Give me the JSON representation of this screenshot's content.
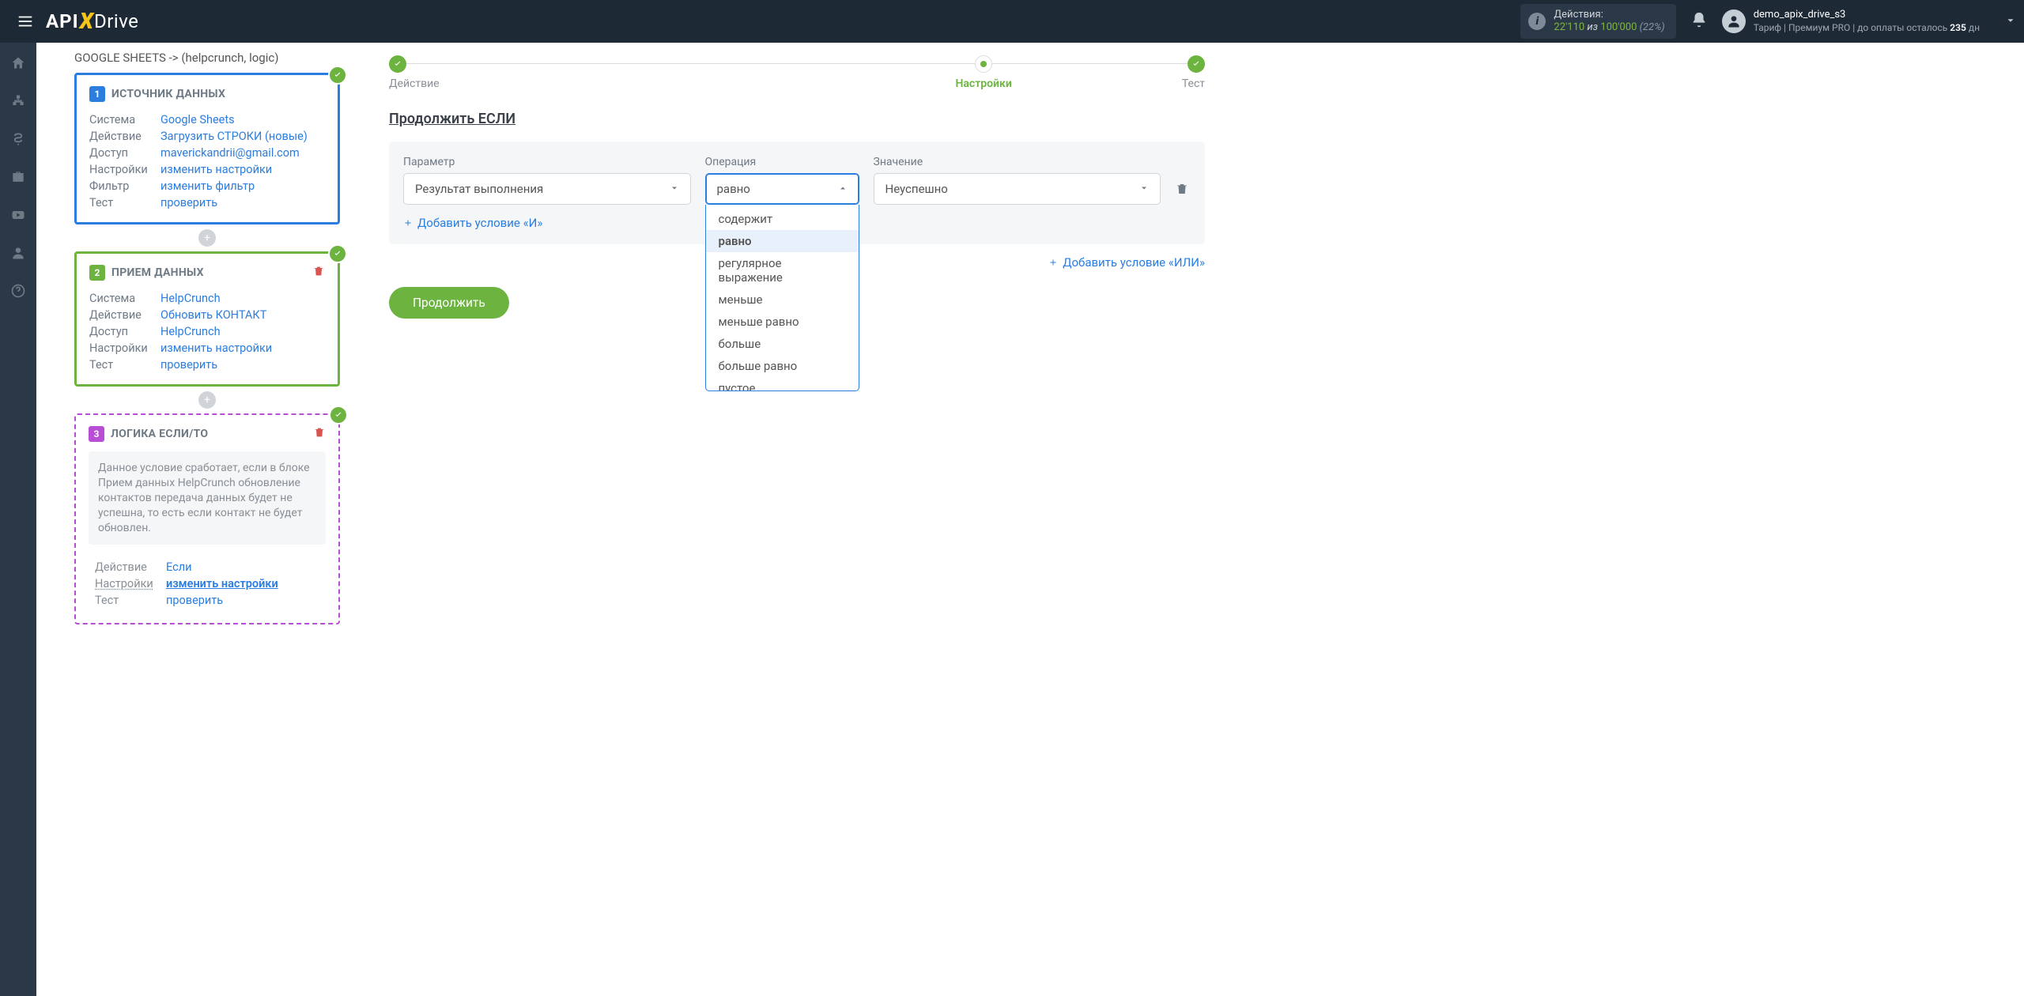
{
  "header": {
    "logo_api": "API",
    "logo_x": "X",
    "logo_drive": "Drive",
    "actions_label": "Действия:",
    "actions_count": "22'110",
    "actions_of": " из ",
    "actions_total": "100'000",
    "actions_pct": " (22%)",
    "user_name": "demo_apix_drive_s3",
    "user_meta_prefix": "Тариф | Премиум PRO |  до оплаты осталось ",
    "user_meta_days": "235",
    "user_meta_suffix": " дн"
  },
  "breadcrumb_title": "GOOGLE SHEETS -> (helpcrunch, logic)",
  "source_card": {
    "title": "ИСТОЧНИК ДАННЫХ",
    "rows": {
      "system_k": "Система",
      "system_v": "Google Sheets",
      "action_k": "Действие",
      "action_v": "Загрузить СТРОКИ (новые)",
      "access_k": "Доступ",
      "access_v": "maverickandrii@gmail.com",
      "settings_k": "Настройки",
      "settings_v": "изменить настройки",
      "filter_k": "Фильтр",
      "filter_v": "изменить фильтр",
      "test_k": "Тест",
      "test_v": "проверить"
    }
  },
  "dest_card": {
    "title": "ПРИЕМ ДАННЫХ",
    "rows": {
      "system_k": "Система",
      "system_v": "HelpCrunch",
      "action_k": "Действие",
      "action_v": "Обновить КОНТАКТ",
      "access_k": "Доступ",
      "access_v": "HelpCrunch",
      "settings_k": "Настройки",
      "settings_v": "изменить настройки",
      "test_k": "Тест",
      "test_v": "проверить"
    }
  },
  "logic_card": {
    "title": "ЛОГИКА ЕСЛИ/ТО",
    "desc": "Данное условие сработает, если в блоке Прием данных HelpCrunch обновление контактов передача данных будет не успешна, то есть если контакт не будет обновлен.",
    "rows": {
      "action_k": "Действие",
      "action_v": "Если",
      "settings_k": "Настройки",
      "settings_v": "изменить настройки",
      "test_k": "Тест",
      "test_v": "проверить"
    }
  },
  "stepper": {
    "step1": "Действие",
    "step2": "Настройки",
    "step3": "Тест"
  },
  "condition": {
    "section_title": "Продолжить ЕСЛИ",
    "param_label": "Параметр",
    "param_value": "Результат выполнения",
    "op_label": "Операция",
    "op_value": "равно",
    "op_options": [
      "содержит",
      "равно",
      "регулярное выражение",
      "меньше",
      "меньше равно",
      "больше",
      "больше равно",
      "пустое"
    ],
    "val_label": "Значение",
    "val_value": "Неуспешно",
    "add_and": "Добавить условие «И»",
    "add_or": "Добавить условие «ИЛИ»"
  },
  "continue_btn": "Продолжить",
  "step_num": {
    "one": "1",
    "two": "2",
    "three": "3"
  }
}
